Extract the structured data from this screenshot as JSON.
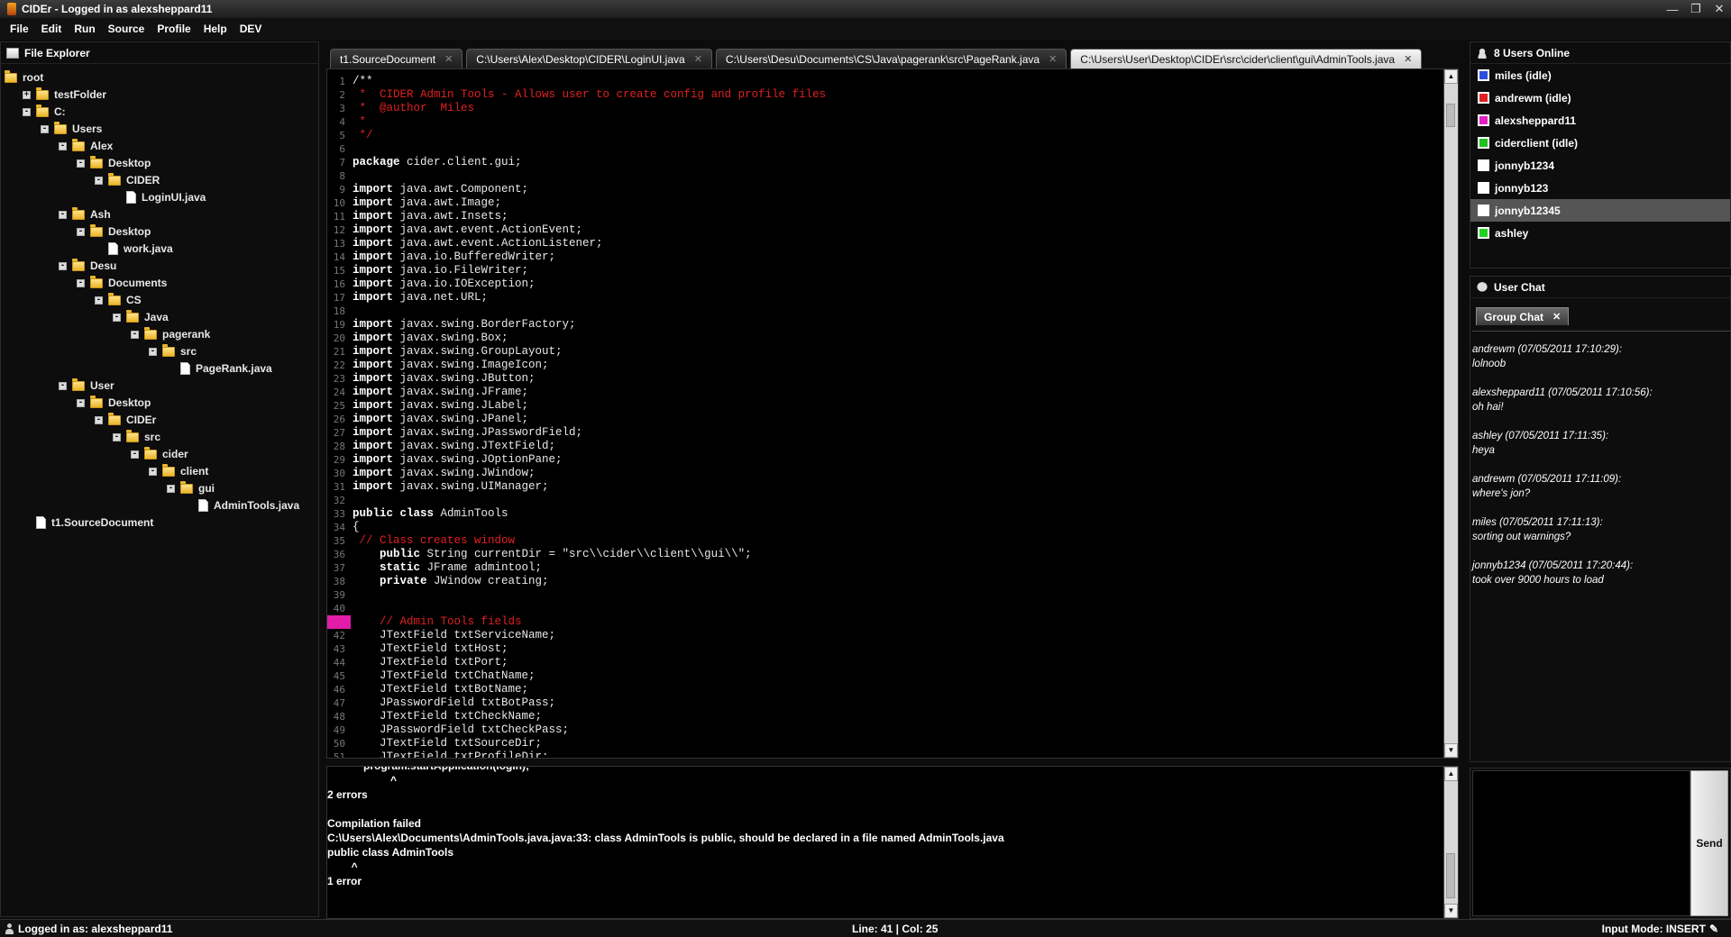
{
  "window": {
    "title": "CIDEr - Logged in as alexsheppard11"
  },
  "menu": [
    "File",
    "Edit",
    "Run",
    "Source",
    "Profile",
    "Help",
    "DEV"
  ],
  "explorer": {
    "title": "File Explorer",
    "tree": [
      {
        "label": "root",
        "type": "folder",
        "depth": 0,
        "toggle": ""
      },
      {
        "label": "testFolder",
        "type": "folder",
        "depth": 1,
        "toggle": "+"
      },
      {
        "label": "C:",
        "type": "folder",
        "depth": 1,
        "toggle": "-"
      },
      {
        "label": "Users",
        "type": "folder",
        "depth": 2,
        "toggle": "-"
      },
      {
        "label": "Alex",
        "type": "folder",
        "depth": 3,
        "toggle": "-"
      },
      {
        "label": "Desktop",
        "type": "folder",
        "depth": 4,
        "toggle": "-"
      },
      {
        "label": "CIDER",
        "type": "folder",
        "depth": 5,
        "toggle": "-"
      },
      {
        "label": "LoginUI.java",
        "type": "file",
        "depth": 6,
        "toggle": ""
      },
      {
        "label": "Ash",
        "type": "folder",
        "depth": 3,
        "toggle": "-"
      },
      {
        "label": "Desktop",
        "type": "folder",
        "depth": 4,
        "toggle": "-"
      },
      {
        "label": "work.java",
        "type": "file",
        "depth": 5,
        "toggle": ""
      },
      {
        "label": "Desu",
        "type": "folder",
        "depth": 3,
        "toggle": "-"
      },
      {
        "label": "Documents",
        "type": "folder",
        "depth": 4,
        "toggle": "-"
      },
      {
        "label": "CS",
        "type": "folder",
        "depth": 5,
        "toggle": "-"
      },
      {
        "label": "Java",
        "type": "folder",
        "depth": 6,
        "toggle": "-"
      },
      {
        "label": "pagerank",
        "type": "folder",
        "depth": 7,
        "toggle": "-"
      },
      {
        "label": "src",
        "type": "folder",
        "depth": 8,
        "toggle": "-"
      },
      {
        "label": "PageRank.java",
        "type": "file",
        "depth": 9,
        "toggle": ""
      },
      {
        "label": "User",
        "type": "folder",
        "depth": 3,
        "toggle": "-"
      },
      {
        "label": "Desktop",
        "type": "folder",
        "depth": 4,
        "toggle": "-"
      },
      {
        "label": "CIDEr",
        "type": "folder",
        "depth": 5,
        "toggle": "-"
      },
      {
        "label": "src",
        "type": "folder",
        "depth": 6,
        "toggle": "-"
      },
      {
        "label": "cider",
        "type": "folder",
        "depth": 7,
        "toggle": "-"
      },
      {
        "label": "client",
        "type": "folder",
        "depth": 8,
        "toggle": "-"
      },
      {
        "label": "gui",
        "type": "folder",
        "depth": 9,
        "toggle": "-"
      },
      {
        "label": "AdminTools.java",
        "type": "file",
        "depth": 10,
        "toggle": ""
      },
      {
        "label": "t1.SourceDocument",
        "type": "file",
        "depth": 1,
        "toggle": ""
      }
    ]
  },
  "tabs": [
    {
      "label": "t1.SourceDocument",
      "active": false
    },
    {
      "label": "C:\\Users\\Alex\\Desktop\\CIDER\\LoginUI.java",
      "active": false
    },
    {
      "label": "C:\\Users\\Desu\\Documents\\CS\\Java\\pagerank\\src\\PageRank.java",
      "active": false
    },
    {
      "label": "C:\\Users\\User\\Desktop\\CIDEr\\src\\cider\\client\\gui\\AdminTools.java",
      "active": true
    }
  ],
  "tab_close": "✕",
  "editor": {
    "highlighted_line": 41,
    "lines": [
      {
        "n": "1",
        "t": "/**",
        "k": ""
      },
      {
        "n": "2",
        "t": " *  CIDER Admin Tools - Allows user to create config and profile files",
        "k": "comment"
      },
      {
        "n": "3",
        "t": " *  @author  Miles",
        "k": "comment"
      },
      {
        "n": "4",
        "t": " *",
        "k": "comment"
      },
      {
        "n": "5",
        "t": " */",
        "k": "comment"
      },
      {
        "n": "6",
        "t": "",
        "k": ""
      },
      {
        "n": "7",
        "t": "package cider.client.gui;",
        "k": "kw:package"
      },
      {
        "n": "8",
        "t": "",
        "k": ""
      },
      {
        "n": "9",
        "t": "import java.awt.Component;",
        "k": "kw:import"
      },
      {
        "n": "10",
        "t": "import java.awt.Image;",
        "k": "kw:import"
      },
      {
        "n": "11",
        "t": "import java.awt.Insets;",
        "k": "kw:import"
      },
      {
        "n": "12",
        "t": "import java.awt.event.ActionEvent;",
        "k": "kw:import"
      },
      {
        "n": "13",
        "t": "import java.awt.event.ActionListener;",
        "k": "kw:import"
      },
      {
        "n": "14",
        "t": "import java.io.BufferedWriter;",
        "k": "kw:import"
      },
      {
        "n": "15",
        "t": "import java.io.FileWriter;",
        "k": "kw:import"
      },
      {
        "n": "16",
        "t": "import java.io.IOException;",
        "k": "kw:import"
      },
      {
        "n": "17",
        "t": "import java.net.URL;",
        "k": "kw:import"
      },
      {
        "n": "18",
        "t": "",
        "k": ""
      },
      {
        "n": "19",
        "t": "import javax.swing.BorderFactory;",
        "k": "kw:import"
      },
      {
        "n": "20",
        "t": "import javax.swing.Box;",
        "k": "kw:import"
      },
      {
        "n": "21",
        "t": "import javax.swing.GroupLayout;",
        "k": "kw:import"
      },
      {
        "n": "22",
        "t": "import javax.swing.ImageIcon;",
        "k": "kw:import"
      },
      {
        "n": "23",
        "t": "import javax.swing.JButton;",
        "k": "kw:import"
      },
      {
        "n": "24",
        "t": "import javax.swing.JFrame;",
        "k": "kw:import"
      },
      {
        "n": "25",
        "t": "import javax.swing.JLabel;",
        "k": "kw:import"
      },
      {
        "n": "26",
        "t": "import javax.swing.JPanel;",
        "k": "kw:import"
      },
      {
        "n": "27",
        "t": "import javax.swing.JPasswordField;",
        "k": "kw:import"
      },
      {
        "n": "28",
        "t": "import javax.swing.JTextField;",
        "k": "kw:import"
      },
      {
        "n": "29",
        "t": "import javax.swing.JOptionPane;",
        "k": "kw:import"
      },
      {
        "n": "30",
        "t": "import javax.swing.JWindow;",
        "k": "kw:import"
      },
      {
        "n": "31",
        "t": "import javax.swing.UIManager;",
        "k": "kw:import"
      },
      {
        "n": "32",
        "t": "",
        "k": ""
      },
      {
        "n": "33",
        "t": "public class AdminTools",
        "k": "kw:public class"
      },
      {
        "n": "34",
        "t": "{",
        "k": ""
      },
      {
        "n": "35",
        "t": " // Class creates window",
        "k": "comment"
      },
      {
        "n": "36",
        "t": "    public String currentDir = \"src\\\\cider\\\\client\\\\gui\\\\\";",
        "k": "kw:    public"
      },
      {
        "n": "37",
        "t": "    static JFrame admintool;",
        "k": "kw:    static"
      },
      {
        "n": "38",
        "t": "    private JWindow creating;",
        "k": "kw:    private"
      },
      {
        "n": "39",
        "t": "",
        "k": ""
      },
      {
        "n": "40",
        "t": "",
        "k": ""
      },
      {
        "n": "41",
        "t": "    // Admin Tools fields",
        "k": "comment"
      },
      {
        "n": "42",
        "t": "    JTextField txtServiceName;",
        "k": ""
      },
      {
        "n": "43",
        "t": "    JTextField txtHost;",
        "k": ""
      },
      {
        "n": "44",
        "t": "    JTextField txtPort;",
        "k": ""
      },
      {
        "n": "45",
        "t": "    JTextField txtChatName;",
        "k": ""
      },
      {
        "n": "46",
        "t": "    JTextField txtBotName;",
        "k": ""
      },
      {
        "n": "47",
        "t": "    JPasswordField txtBotPass;",
        "k": ""
      },
      {
        "n": "48",
        "t": "    JTextField txtCheckName;",
        "k": ""
      },
      {
        "n": "49",
        "t": "    JPasswordField txtCheckPass;",
        "k": ""
      },
      {
        "n": "50",
        "t": "    JTextField txtSourceDir;",
        "k": ""
      },
      {
        "n": "51",
        "t": "    JTextField txtProfileDir;",
        "k": ""
      }
    ]
  },
  "console": {
    "lines": [
      "            program.startApplication(login);",
      "                     ^",
      "2 errors",
      "",
      "Compilation failed",
      "C:\\Users\\Alex\\Documents\\AdminTools.java.java:33: class AdminTools is public, should be declared in a file named AdminTools.java",
      "public class AdminTools",
      "        ^",
      "1 error"
    ]
  },
  "users": {
    "title": "8 Users Online",
    "list": [
      {
        "name": "miles (idle)",
        "color": "#2a4de0",
        "selected": false
      },
      {
        "name": "andrewm (idle)",
        "color": "#e02020",
        "selected": false
      },
      {
        "name": "alexsheppard11",
        "color": "#e020c0",
        "selected": false
      },
      {
        "name": "ciderclient (idle)",
        "color": "#20c020",
        "selected": false
      },
      {
        "name": "jonnyb1234",
        "color": "#ffffff",
        "selected": false
      },
      {
        "name": "jonnyb123",
        "color": "#ffffff",
        "selected": false
      },
      {
        "name": "jonnyb12345",
        "color": "#ffffff",
        "selected": true
      },
      {
        "name": "ashley",
        "color": "#20d020",
        "selected": false
      }
    ]
  },
  "chat": {
    "title": "User Chat",
    "tab": "Group Chat",
    "messages": [
      {
        "head": "andrewm (07/05/2011 17:10:29):",
        "body": "lolnoob"
      },
      {
        "head": "alexsheppard11 (07/05/2011 17:10:56):",
        "body": "oh hai!"
      },
      {
        "head": "ashley (07/05/2011 17:11:35):",
        "body": "heya"
      },
      {
        "head": "andrewm (07/05/2011 17:11:09):",
        "body": "where's jon?"
      },
      {
        "head": "miles (07/05/2011 17:11:13):",
        "body": "sorting out warnings?"
      },
      {
        "head": "jonnyb1234 (07/05/2011 17:20:44):",
        "body": "took over 9000 hours to load"
      }
    ],
    "send_label": "Send"
  },
  "status": {
    "left": "Logged in as: alexsheppard11",
    "middle": "Line: 41 | Col: 25",
    "right": "Input Mode: INSERT"
  },
  "icons": {
    "minimize": "—",
    "restore": "❐",
    "close": "✕"
  }
}
